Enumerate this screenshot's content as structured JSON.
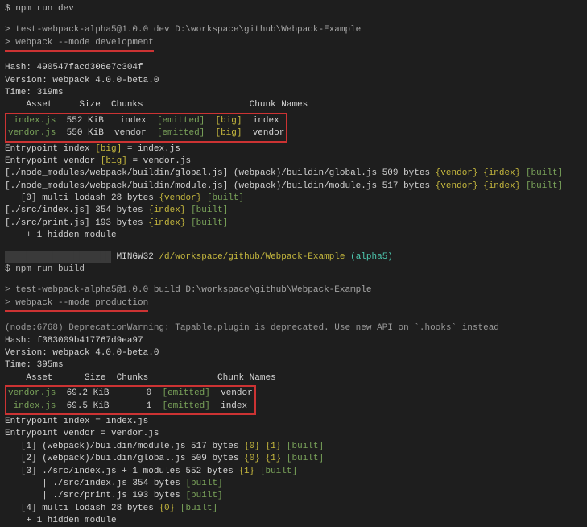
{
  "cmd1": "$ npm run dev",
  "dev": {
    "scriptLine": "> test-webpack-alpha5@1.0.0 dev D:\\workspace\\github\\Webpack-Example",
    "runLine": "> webpack --mode development",
    "hash": "Hash: 490547facd306e7c304f",
    "version": "Version: webpack 4.0.0-beta.0",
    "time": "Time: 319ms",
    "header": "    Asset     Size  Chunks                    Chunk Names",
    "row1": {
      "asset": " index.js",
      "size": "552 KiB",
      "chunk": "index",
      "emitted": "[emitted]",
      "big": "[big]",
      "name": "index"
    },
    "row2": {
      "asset": "vendor.js",
      "size": "550 KiB",
      "chunk": "vendor",
      "emitted": "[emitted]",
      "big": "[big]",
      "name": "vendor"
    },
    "entry1a": "Entrypoint index ",
    "entry1b": "[big]",
    "entry1c": " = index.js",
    "entry2a": "Entrypoint vendor ",
    "entry2b": "[big]",
    "entry2c": " = vendor.js",
    "m1a": "[./node_modules/webpack/buildin/global.js] (webpack)/buildin/global.js 509 bytes ",
    "m1b": "{vendor}",
    "m1c": " ",
    "m1d": "{index}",
    "m1e": " ",
    "m1f": "[built]",
    "m2a": "[./node_modules/webpack/buildin/module.js] (webpack)/buildin/module.js 517 bytes ",
    "m2b": "{vendor}",
    "m2c": " ",
    "m2d": "{index}",
    "m2e": " ",
    "m2f": "[built]",
    "m3a": "   [0] multi lodash 28 bytes ",
    "m3b": "{vendor}",
    "m3c": " ",
    "m3d": "[built]",
    "m4a": "[./src/index.js] 354 bytes ",
    "m4b": "{index}",
    "m4c": " ",
    "m4d": "[built]",
    "m5a": "[./src/print.js] 193 bytes ",
    "m5b": "{index}",
    "m5c": " ",
    "m5d": "[built]",
    "hidden": "    + 1 hidden module"
  },
  "shell": {
    "blurred": "████████████████████",
    "mingw": " MINGW32 ",
    "path": "/d/workspace/github/Webpack-Example ",
    "branch": "(alpha5)"
  },
  "cmd2": "$ npm run build",
  "build": {
    "scriptLine": "> test-webpack-alpha5@1.0.0 build D:\\workspace\\github\\Webpack-Example",
    "runLine": "> webpack --mode production",
    "depwarn": "(node:6768) DeprecationWarning: Tapable.plugin is deprecated. Use new API on `.hooks` instead",
    "hash": "Hash: f383009b417767d9ea97",
    "version": "Version: webpack 4.0.0-beta.0",
    "time": "Time: 395ms",
    "header": "    Asset      Size  Chunks             Chunk Names",
    "row1": {
      "asset": "vendor.js",
      "size": "69.2 KiB",
      "chunk": "0",
      "emitted": "[emitted]",
      "name": "vendor"
    },
    "row2": {
      "asset": " index.js",
      "size": "69.5 KiB",
      "chunk": "1",
      "emitted": "[emitted]",
      "name": "index"
    },
    "entry1": "Entrypoint index = index.js",
    "entry2": "Entrypoint vendor = vendor.js",
    "m1a": "   [1] (webpack)/buildin/module.js 517 bytes ",
    "m1b": "{0}",
    "m1c": " ",
    "m1d": "{1}",
    "m1e": " ",
    "m1f": "[built]",
    "m2a": "   [2] (webpack)/buildin/global.js 509 bytes ",
    "m2b": "{0}",
    "m2c": " ",
    "m2d": "{1}",
    "m2e": " ",
    "m2f": "[built]",
    "m3a": "   [3] ./src/index.js + 1 modules 552 bytes ",
    "m3b": "{1}",
    "m3c": " ",
    "m3d": "[built]",
    "m4a": "       | ./src/index.js 354 bytes ",
    "m4b": "[built]",
    "m5a": "       | ./src/print.js 193 bytes ",
    "m5b": "[built]",
    "m6a": "   [4] multi lodash 28 bytes ",
    "m6b": "{0}",
    "m6c": " ",
    "m6d": "[built]",
    "hidden": "    + 1 hidden module"
  }
}
